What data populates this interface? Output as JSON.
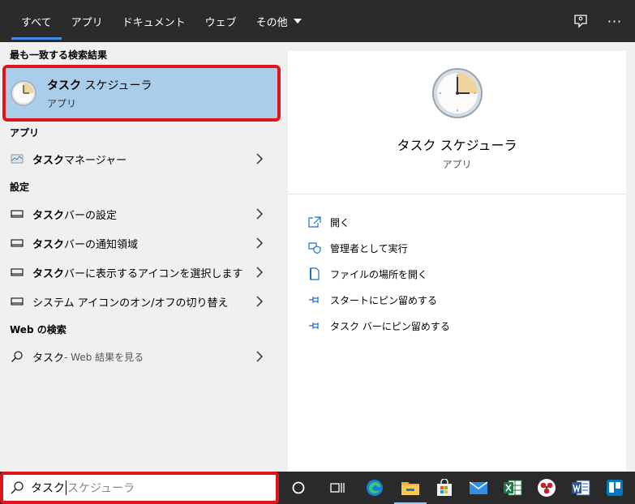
{
  "tabs": [
    {
      "label": "すべて",
      "active": true
    },
    {
      "label": "アプリ",
      "active": false
    },
    {
      "label": "ドキュメント",
      "active": false
    },
    {
      "label": "ウェブ",
      "active": false
    },
    {
      "label": "その他",
      "active": false
    }
  ],
  "top_icons": [
    "feedback-icon",
    "more-icon"
  ],
  "top_more_label": "···",
  "best_match": {
    "header": "最も一致する検索結果",
    "name_bold": "タスク",
    "name_rest": " スケジューラ",
    "type": "アプリ"
  },
  "apps": {
    "header": "アプリ",
    "items": [
      {
        "bold": "タスク",
        "rest": " マネージャー",
        "icon": "task-manager-icon"
      }
    ]
  },
  "settings": {
    "header": "設定",
    "items": [
      {
        "bold": "タスク",
        "rest": " バーの設定",
        "icon": "taskbar-icon"
      },
      {
        "bold": "タスク",
        "rest": " バーの通知領域",
        "icon": "taskbar-icon"
      },
      {
        "bold": "タスク",
        "rest": " バーに表示するアイコンを選択します",
        "icon": "taskbar-icon"
      },
      {
        "bold": "",
        "rest": "システム アイコンのオン/オフの切り替え",
        "icon": "taskbar-icon"
      }
    ]
  },
  "web": {
    "header": "Web の検索",
    "query": "タスク",
    "suffix": " - Web 結果を見る"
  },
  "preview": {
    "title": "タスク スケジューラ",
    "subtitle": "アプリ",
    "actions": [
      {
        "label": "開く",
        "icon": "open-icon"
      },
      {
        "label": "管理者として実行",
        "icon": "shield-icon"
      },
      {
        "label": "ファイルの場所を開く",
        "icon": "file-location-icon"
      },
      {
        "label": "スタートにピン留めする",
        "icon": "pin-icon"
      },
      {
        "label": "タスク バーにピン留めする",
        "icon": "pin-icon"
      }
    ]
  },
  "search": {
    "typed": "タスク",
    "suggestion": "スケジューラ"
  },
  "taskbar_icons": [
    "cortana-icon",
    "task-view-icon",
    "edge-icon",
    "file-explorer-icon",
    "store-icon",
    "mail-icon",
    "excel-icon",
    "app-icon",
    "word-icon",
    "trello-icon"
  ],
  "colors": {
    "accent": "#3b8de6",
    "highlight": "#aacdea",
    "annotation": "#e0141b",
    "link_icon": "#1e6fc9"
  }
}
